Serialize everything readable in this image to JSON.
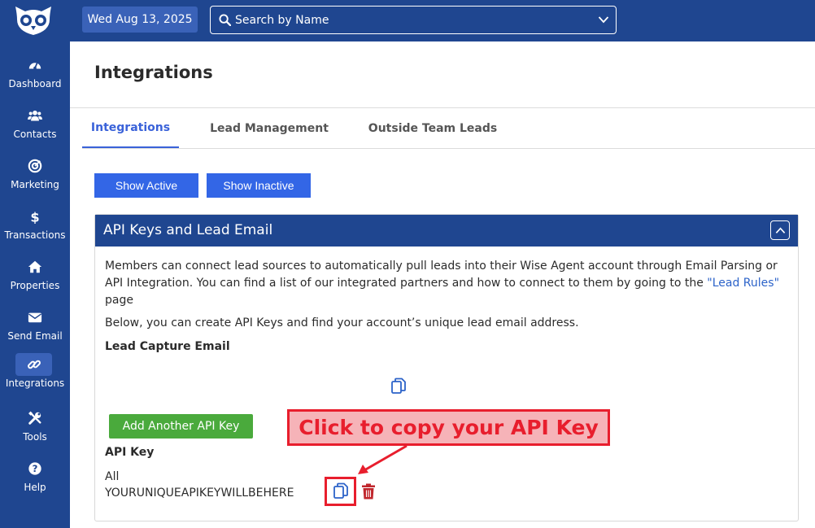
{
  "topbar": {
    "date": "Wed Aug 13, 2025",
    "search_placeholder": "Search by Name"
  },
  "sidebar": {
    "items": [
      {
        "label": "Dashboard",
        "icon": "gauge-icon"
      },
      {
        "label": "Contacts",
        "icon": "users-icon"
      },
      {
        "label": "Marketing",
        "icon": "target-icon"
      },
      {
        "label": "Transactions",
        "icon": "dollar-icon"
      },
      {
        "label": "Properties",
        "icon": "home-icon"
      },
      {
        "label": "Send Email",
        "icon": "envelope-icon"
      },
      {
        "label": "Integrations",
        "icon": "link-icon",
        "active": true
      },
      {
        "label": "Tools",
        "icon": "tools-icon"
      },
      {
        "label": "Help",
        "icon": "question-icon"
      }
    ]
  },
  "page": {
    "title": "Integrations",
    "tabs": [
      {
        "label": "Integrations",
        "active": true
      },
      {
        "label": "Lead Management"
      },
      {
        "label": "Outside Team Leads"
      }
    ],
    "show_active_label": "Show Active",
    "show_inactive_label": "Show Inactive"
  },
  "panel": {
    "title": "API Keys and Lead Email",
    "description_before": "Members can connect lead sources to automatically pull leads into their Wise Agent account through Email Parsing or API Integration. You can find a list of our integrated partners and how to connect to them by going to the ",
    "description_link": "\"Lead Rules\"",
    "description_after": " page",
    "description2": "Below, you can create API Keys and find your account’s unique lead email address.",
    "lead_capture_label": "Lead Capture Email",
    "add_key_label": "Add Another API Key",
    "api_key_label": "API Key",
    "api_key_scope": "All",
    "api_key_value": "YOURUNIQUEAPIKEYWILLBEHERE"
  },
  "annotation": {
    "text": "Click to copy your API Key"
  },
  "colors": {
    "nav_bg": "#1f4690",
    "accent_blue": "#3366e6",
    "accent_green": "#4aaa3c",
    "annotation_red": "#e81e2d",
    "delete_red": "#c0262c"
  }
}
